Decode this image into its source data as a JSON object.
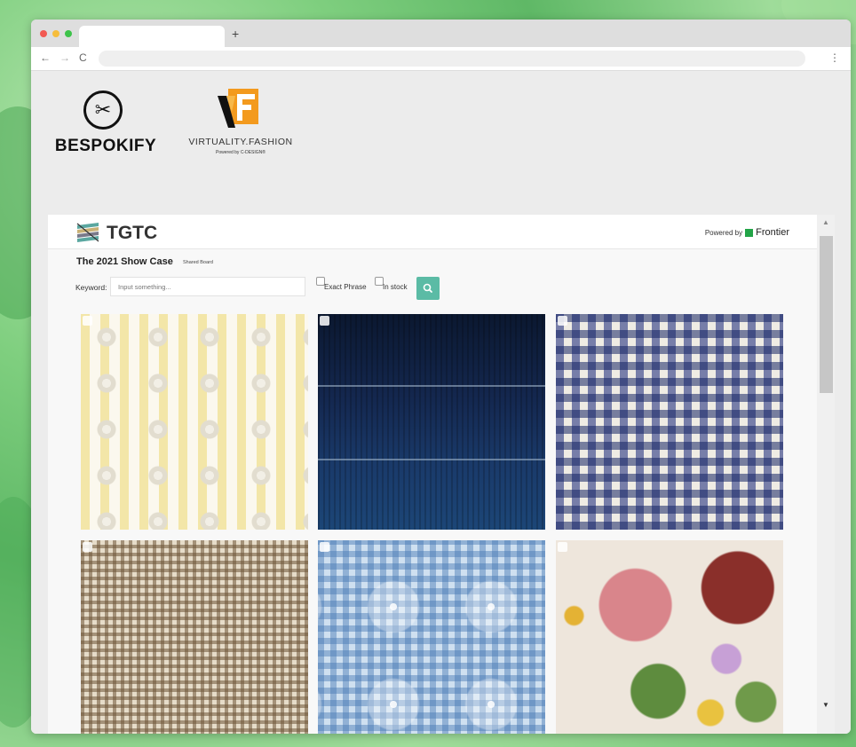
{
  "browser": {
    "tab_label": "",
    "new_tab": "+",
    "nav": {
      "back": "←",
      "forward": "→",
      "reload": "C",
      "menu": "⋮"
    },
    "address": ""
  },
  "logos": {
    "bespokify": "BESPOKIFY",
    "virtuality": "VIRTUALITY.FASHION",
    "virtuality_sub": "Powered by C-DESIGN®"
  },
  "panel": {
    "brand": "TGTC",
    "powered_by": "Powered by",
    "frontier": "Frontier",
    "board_title": "The 2021 Show Case",
    "board_subtitle": "Shared Board",
    "keyword_label": "Keyword:",
    "keyword_placeholder": "Input something...",
    "keyword_value": "",
    "exact_phrase": "Exact Phrase",
    "in_stock": "In stock",
    "search_icon": "search-icon"
  },
  "colors": {
    "accent": "#5bbba5",
    "frontier_green": "#22a447",
    "vf_orange": "#f39a1e"
  },
  "swatches": [
    {
      "id": "swatch-yellow-eyelet",
      "selected": false
    },
    {
      "id": "swatch-navy-denim",
      "selected": false
    },
    {
      "id": "swatch-blue-gingham",
      "selected": false
    },
    {
      "id": "swatch-brown-seersucker",
      "selected": false
    },
    {
      "id": "swatch-blue-embroidered-gingham",
      "selected": false
    },
    {
      "id": "swatch-floral-print",
      "selected": false
    }
  ]
}
